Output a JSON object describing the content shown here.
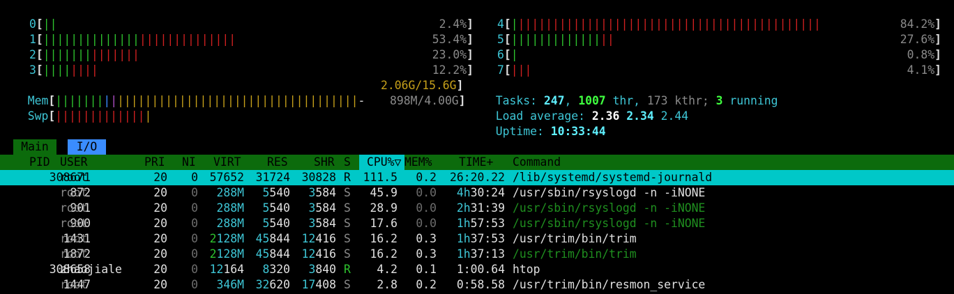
{
  "cpus": [
    {
      "id": "0",
      "pct": "2.4%",
      "green": 2,
      "red": 0
    },
    {
      "id": "1",
      "pct": "53.4%",
      "green": 14,
      "red": 14
    },
    {
      "id": "2",
      "pct": "23.0%",
      "green": 7,
      "red": 7
    },
    {
      "id": "3",
      "pct": "12.2%",
      "green": 4,
      "red": 4
    },
    {
      "id": "4",
      "pct": "84.2%",
      "green": 1,
      "red": 44
    },
    {
      "id": "5",
      "pct": "27.6%",
      "green": 13,
      "red": 2
    },
    {
      "id": "6",
      "pct": "0.8%",
      "green": 1,
      "red": 0
    },
    {
      "id": "7",
      "pct": "4.1%",
      "green": 0,
      "red": 3
    }
  ],
  "mem": {
    "label": "Mem",
    "value": "2.06G/15.6G"
  },
  "swp": {
    "label": "Swp",
    "value": "898M/4.00G"
  },
  "tasks": {
    "label": "Tasks:",
    "count": "247",
    "thr": "1007",
    "thr_label": "thr,",
    "kthr": "173",
    "kthr_label": "kthr;",
    "running": "3",
    "running_label": "running"
  },
  "load": {
    "label": "Load average:",
    "v1": "2.36",
    "v2": "2.34",
    "v3": "2.44"
  },
  "uptime": {
    "label": "Uptime:",
    "value": "10:33:44"
  },
  "tabs": [
    {
      "label": "Main"
    },
    {
      "label": "I/O"
    }
  ],
  "columns": [
    "PID",
    "USER",
    "PRI",
    "NI",
    "VIRT",
    "RES",
    "SHR",
    "S",
    "CPU%▽",
    "MEM%",
    "TIME+",
    "Command"
  ],
  "processes": [
    {
      "pid": "308671",
      "user": "root",
      "pri": "20",
      "ni": "0",
      "virt": "57652",
      "res": "31724",
      "shr": "30828",
      "s": "R",
      "cpu": "111.5",
      "mem": "0.2",
      "time": "26:20.22",
      "cmd": "/lib/systemd/systemd-journald",
      "selected": true,
      "thread": false
    },
    {
      "pid": "872",
      "user": "root",
      "pri": "20",
      "ni": "0",
      "virt": "288M",
      "res": "5540",
      "shr": "3584",
      "s": "S",
      "cpu": "45.9",
      "mem": "0.0",
      "time": "4h30:24",
      "cmd": "/usr/sbin/rsyslogd -n -iNONE",
      "selected": false,
      "thread": false
    },
    {
      "pid": "901",
      "user": "root",
      "pri": "20",
      "ni": "0",
      "virt": "288M",
      "res": "5540",
      "shr": "3584",
      "s": "S",
      "cpu": "28.9",
      "mem": "0.0",
      "time": "2h31:39",
      "cmd": "/usr/sbin/rsyslogd -n -iNONE",
      "selected": false,
      "thread": true
    },
    {
      "pid": "900",
      "user": "root",
      "pri": "20",
      "ni": "0",
      "virt": "288M",
      "res": "5540",
      "shr": "3584",
      "s": "S",
      "cpu": "17.6",
      "mem": "0.0",
      "time": "1h57:53",
      "cmd": "/usr/sbin/rsyslogd -n -iNONE",
      "selected": false,
      "thread": true
    },
    {
      "pid": "1431",
      "user": "root",
      "pri": "20",
      "ni": "0",
      "virt": "2128M",
      "res": "45844",
      "shr": "12416",
      "s": "S",
      "cpu": "16.2",
      "mem": "0.3",
      "time": "1h37:53",
      "cmd": "/usr/trim/bin/trim",
      "selected": false,
      "thread": false
    },
    {
      "pid": "1872",
      "user": "root",
      "pri": "20",
      "ni": "0",
      "virt": "2128M",
      "res": "45844",
      "shr": "12416",
      "s": "S",
      "cpu": "16.2",
      "mem": "0.3",
      "time": "1h37:13",
      "cmd": "/usr/trim/bin/trim",
      "selected": false,
      "thread": true
    },
    {
      "pid": "308658",
      "user": "zhaojiale",
      "pri": "20",
      "ni": "0",
      "virt": "12164",
      "res": "8320",
      "shr": "3840",
      "s": "R",
      "cpu": "4.2",
      "mem": "0.1",
      "time": "1:00.64",
      "cmd": "htop",
      "selected": false,
      "thread": false
    },
    {
      "pid": "1447",
      "user": "root",
      "pri": "20",
      "ni": "0",
      "virt": "346M",
      "res": "32620",
      "shr": "17408",
      "s": "S",
      "cpu": "2.8",
      "mem": "0.2",
      "time": "0:58.58",
      "cmd": "/usr/trim/bin/resmon_service",
      "selected": false,
      "thread": false
    }
  ]
}
